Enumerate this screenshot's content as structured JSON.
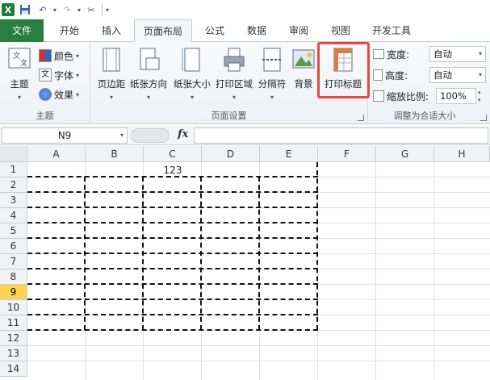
{
  "qat": {
    "undo_icon": "undo-icon",
    "redo_icon": "redo-icon"
  },
  "tabs": [
    {
      "label": "文件"
    },
    {
      "label": "开始"
    },
    {
      "label": "插入"
    },
    {
      "label": "页面布局"
    },
    {
      "label": "公式"
    },
    {
      "label": "数据"
    },
    {
      "label": "审阅"
    },
    {
      "label": "视图"
    },
    {
      "label": "开发工具"
    }
  ],
  "ribbon": {
    "theme_group": {
      "label": "主题",
      "themes_btn": "主题",
      "colors": "颜色",
      "fonts": "字体",
      "effects": "效果"
    },
    "page_setup_group": {
      "label": "页面设置",
      "margins": "页边距",
      "orientation": "纸张方向",
      "size": "纸张大小",
      "print_area": "打印区域",
      "breaks": "分隔符",
      "background": "背景",
      "print_titles": "打印标题"
    },
    "scale_group": {
      "label": "调整为合适大小",
      "width_label": "宽度:",
      "width_value": "自动",
      "height_label": "高度:",
      "height_value": "自动",
      "scale_label": "缩放比例:",
      "scale_value": "100%"
    }
  },
  "formula_bar": {
    "name_box": "N9",
    "fx": "fx",
    "value": ""
  },
  "sheet": {
    "columns": [
      "A",
      "B",
      "C",
      "D",
      "E",
      "F",
      "G",
      "H"
    ],
    "rows": [
      "1",
      "2",
      "3",
      "4",
      "5",
      "6",
      "7",
      "8",
      "9",
      "10",
      "11",
      "12",
      "13",
      "14"
    ],
    "selected_row": "9",
    "c1_value": "123"
  },
  "colors": {
    "file_tab": "#2a7e3f",
    "highlight": "#e04a45",
    "selected_row": "#ffd34f"
  }
}
